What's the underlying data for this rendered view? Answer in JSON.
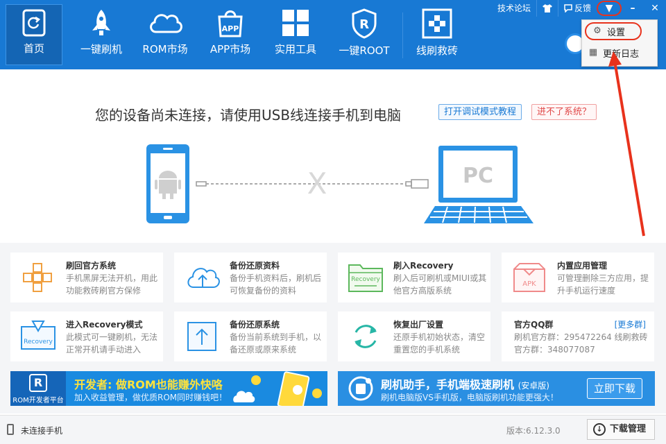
{
  "nav": {
    "items": [
      {
        "label": "首页",
        "icon": "refresh-phone-icon",
        "active": true
      },
      {
        "label": "一键刷机",
        "icon": "rocket-icon"
      },
      {
        "label": "ROM市场",
        "icon": "cloud-icon"
      },
      {
        "label": "APP市场",
        "icon": "app-bag-icon",
        "icon_text": "APP"
      },
      {
        "label": "实用工具",
        "icon": "grid-icon"
      },
      {
        "label": "一键ROOT",
        "icon": "root-shield-icon",
        "icon_text": "R"
      },
      {
        "label": "线刷救砖",
        "icon": "cross-tool-icon"
      }
    ]
  },
  "titlebar": {
    "forum": "技术论坛",
    "feedback": "反馈",
    "menu_icon": "caret-down-icon",
    "min": "–",
    "close": "✕"
  },
  "dropdown": {
    "settings": "设置",
    "changelog": "更新日志"
  },
  "connect": {
    "title": "您的设备尚未连接，请使用USB线连接手机到电脑",
    "tutorial": "打开调试模式教程",
    "help": "进不了系统？",
    "pc_label": "PC",
    "x_mark": "X"
  },
  "features": [
    {
      "title": "刷回官方系统",
      "desc": "手机黑屏无法开机，用此功能救砖刷官方保修",
      "icon": "grid-cross-icon"
    },
    {
      "title": "备份还原资料",
      "desc": "备份手机资料后，刷机后可恢复备份的资料",
      "icon": "cloud-upload-icon"
    },
    {
      "title": "刷入Recovery",
      "desc": "刷入后可刷机或MIUI或其他官方高版系统",
      "icon": "recovery-folder-icon",
      "icon_text": "Recovery"
    },
    {
      "title": "内置应用管理",
      "desc": "可管理删除三方应用，提升手机运行速度",
      "icon": "apk-box-icon",
      "icon_text": "APK"
    },
    {
      "title": "进入Recovery模式",
      "desc": "此模式可一键刷机，无法正常开机请手动进入",
      "icon": "recovery-mode-icon",
      "icon_text": "Recovery"
    },
    {
      "title": "备份还原系统",
      "desc": "备份当前系统到手机，以备还原或原来系统",
      "icon": "upload-box-icon"
    },
    {
      "title": "恢复出厂设置",
      "desc": "还原手机初始状态，清空重置您的手机系统",
      "icon": "reset-cycle-icon"
    },
    {
      "title": "官方QQ群",
      "desc": "刷机官方群：295472264 线刷救砖官方群：348077087",
      "icon": "",
      "more": "[更多群]"
    }
  ],
  "banners": {
    "dev": {
      "title_prefix": "开发者:",
      "title_main": "做ROM也能赚外快咯",
      "sub": "加入收益管理，做优质ROM同时赚钱吧！",
      "logo_text": "ROM开发者平台",
      "logo_letter": "R"
    },
    "app": {
      "title": "刷机助手，手机端极速刷机",
      "title_tag": "(安卓版)",
      "sub": "刷机电脑版VS手机版，电脑版刷机功能更强大！",
      "button": "立即下载"
    }
  },
  "status": {
    "text": "未连接手机",
    "version": "版本:6.12.3.0",
    "download": "下载管理"
  },
  "colors": {
    "header_bg": "#1879d4",
    "accent": "#1879d4",
    "highlight_red": "#e8321c",
    "icon_orange": "#f0a040",
    "icon_blue": "#2a92e4",
    "icon_green": "#5cb85c",
    "icon_pink": "#f08a8a"
  }
}
